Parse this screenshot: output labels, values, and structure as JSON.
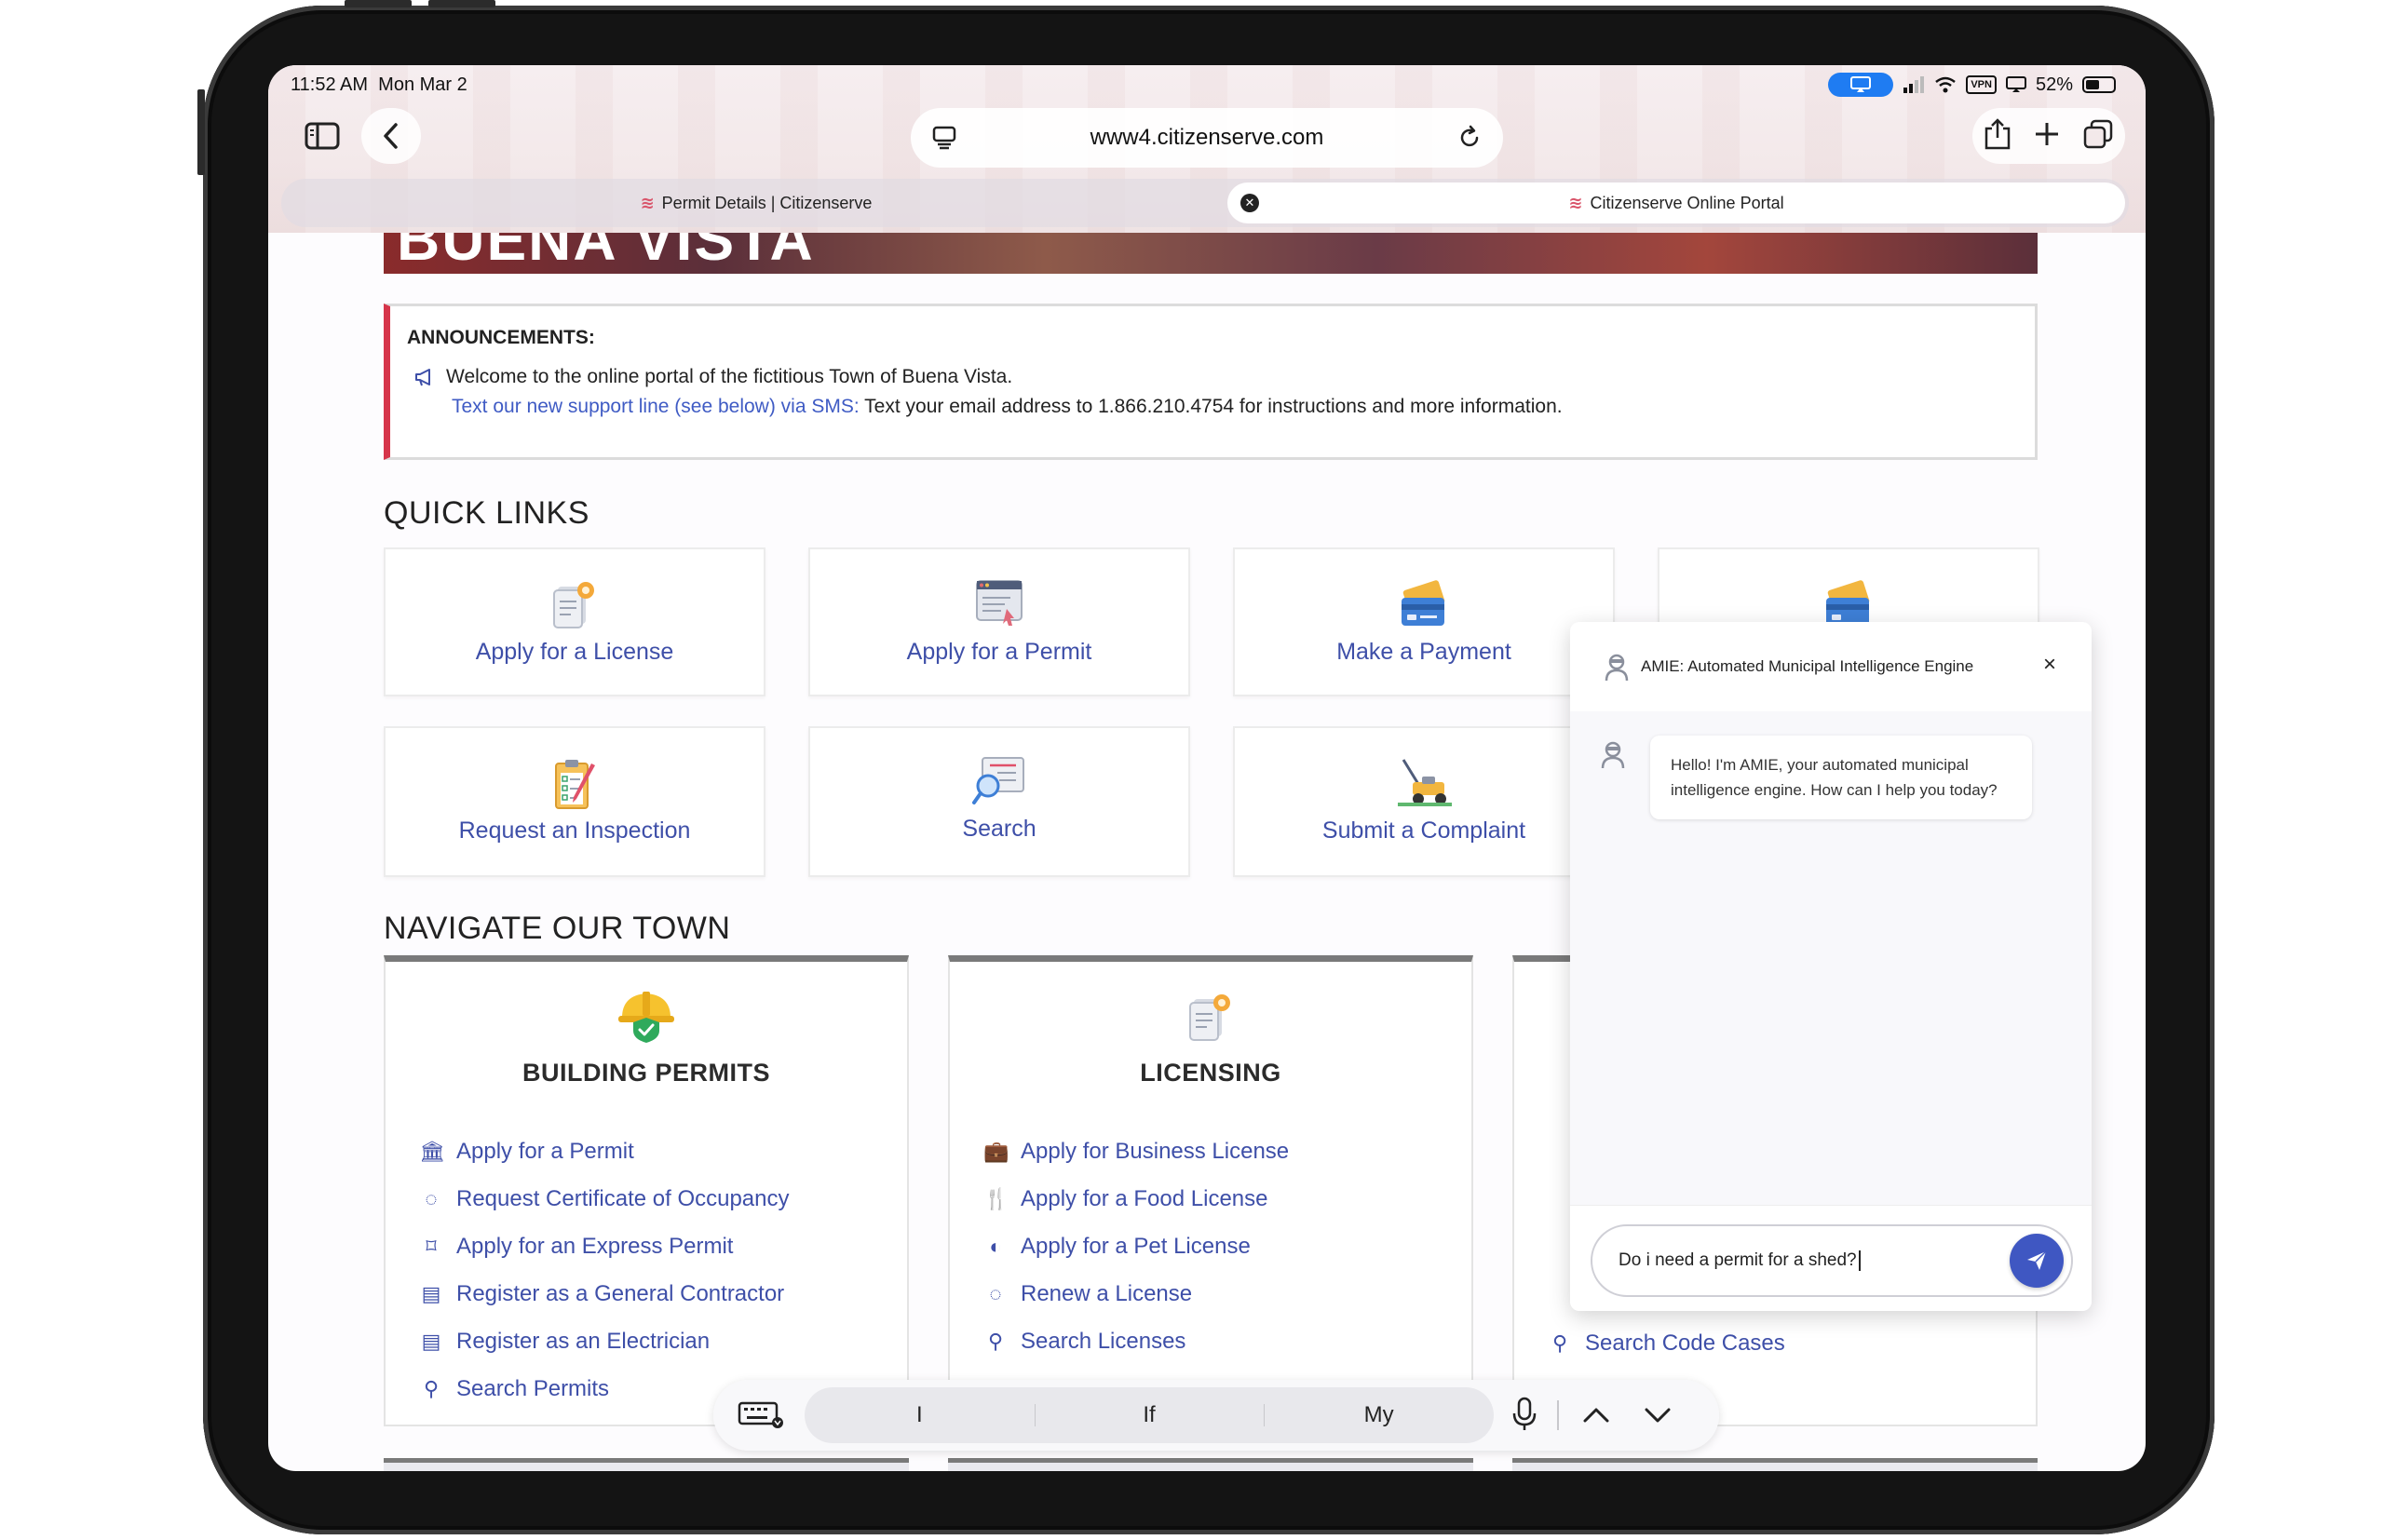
{
  "status": {
    "time": "11:52 AM",
    "date": "Mon Mar 2",
    "vpn": "VPN",
    "battery": "52%"
  },
  "browser": {
    "url": "www4.citizenserve.com",
    "tabs": [
      {
        "label": "Permit Details | Citizenserve",
        "active": false
      },
      {
        "label": "Citizenserve Online Portal",
        "active": true
      }
    ]
  },
  "banner": {
    "title": "BUENA VISTA"
  },
  "announcements": {
    "title": "ANNOUNCEMENTS:",
    "line1": "Welcome to the online portal of the fictitious Town of Buena Vista.",
    "line2_link": "Text our new support line (see below) via SMS:",
    "line2_text": "Text your email address to 1.866.210.4754  for instructions and more information."
  },
  "quick_links": {
    "title": "QUICK LINKS",
    "items": [
      {
        "label": "Apply for a License",
        "icon": "license-icon"
      },
      {
        "label": "Apply for a Permit",
        "icon": "permit-icon"
      },
      {
        "label": "Make a Payment",
        "icon": "payment-card-icon"
      },
      {
        "label": "",
        "icon": "payment-card-icon"
      },
      {
        "label": "Request an Inspection",
        "icon": "inspection-clipboard-icon"
      },
      {
        "label": "Search",
        "icon": "search-document-icon"
      },
      {
        "label": "Submit a Complaint",
        "icon": "lawnmower-icon"
      }
    ]
  },
  "navigate": {
    "title": "NAVIGATE OUR TOWN",
    "cards": [
      {
        "title": "BUILDING PERMITS",
        "icon": "hardhat-shield-icon",
        "items": [
          {
            "label": "Apply for a Permit",
            "icon": "bank-icon"
          },
          {
            "label": "Request Certificate of Occupancy",
            "icon": "spinner-icon"
          },
          {
            "label": "Apply for an Express Permit",
            "icon": "tag-icon"
          },
          {
            "label": "Register as a General Contractor",
            "icon": "id-card-icon"
          },
          {
            "label": "Register as an Electrician",
            "icon": "id-card-icon"
          },
          {
            "label": "Search Permits",
            "icon": "search-icon"
          }
        ]
      },
      {
        "title": "LICENSING",
        "icon": "license-icon",
        "items": [
          {
            "label": "Apply for Business License",
            "icon": "briefcase-icon"
          },
          {
            "label": "Apply for a Food License",
            "icon": "utensils-icon"
          },
          {
            "label": "Apply for a Pet License",
            "icon": "paw-icon"
          },
          {
            "label": "Renew a License",
            "icon": "spinner-icon"
          },
          {
            "label": "Search Licenses",
            "icon": "search-icon"
          }
        ]
      },
      {
        "title": "",
        "icon": "",
        "items": [
          {
            "label": "Search Code Cases",
            "icon": "search-icon"
          }
        ]
      }
    ]
  },
  "chat": {
    "title": "AMIE: Automated Municipal Intelligence Engine",
    "close": "×",
    "bot_message": "Hello! I'm AMIE, your automated municipal intelligence engine. How can I help you today?",
    "input_value": "Do i need a permit for a shed?"
  },
  "keyboard": {
    "suggestions": [
      "I",
      "If",
      "My"
    ]
  },
  "colors": {
    "link_blue": "#3e4fa8",
    "accent_red": "#d6354a",
    "send_button": "#3f57c2"
  }
}
